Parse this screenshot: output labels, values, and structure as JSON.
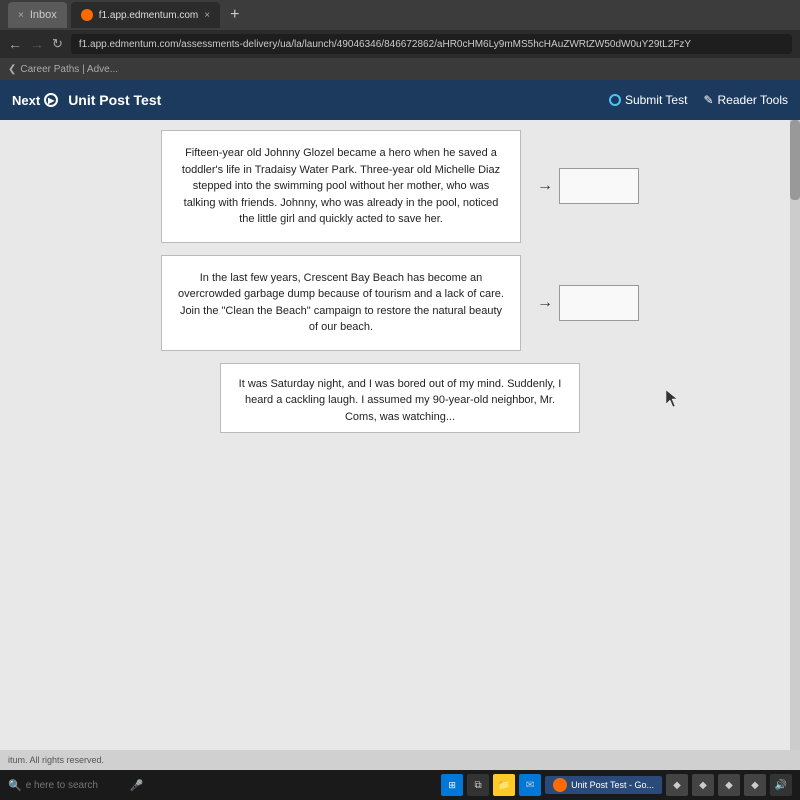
{
  "browser": {
    "tabs": [
      {
        "label": "×",
        "title": "Inbox",
        "active": false
      },
      {
        "label": "×",
        "title": "f1.app.edmentum.com/assessments-delivery/ua/la/launch/49046346/846672862/aHR0cHM6Ly9mMS5hcHAuZWRtZW50dW0uY29tL2FzY...",
        "active": true
      }
    ],
    "new_tab": "+",
    "address": "f1.app.edmentum.com/assessments-delivery/ua/la/launch/49046346/846672862/aHR0cHM6Ly9mMS5hcHAuZWRtZW50dW0uY29tL2FzY",
    "breadcrumb": "Career Paths | Adve..."
  },
  "header": {
    "next_label": "Next",
    "title": "Unit Post Test",
    "submit_label": "Submit Test",
    "reader_tools_label": "Reader Tools"
  },
  "passages": [
    {
      "text": "Fifteen-year old Johnny Glozel became a hero when he saved a toddler's life in Tradaisy Water Park. Three-year old Michelle Diaz stepped into the swimming pool without her mother, who was talking with friends. Johnny, who was already in the pool, noticed the little girl and quickly acted to save her."
    },
    {
      "text": "In the last few years, Crescent Bay Beach has become an overcrowded garbage dump because of tourism and a lack of care. Join the \"Clean the Beach\" campaign to restore the natural beauty of our beach."
    },
    {
      "text": "It was Saturday night, and I was bored out of my mind. Suddenly, I heard a cackling laugh. I assumed my 90-year-old neighbor, Mr. Coms, was watching..."
    }
  ],
  "footer": {
    "copyright": "itum. All rights reserved."
  },
  "taskbar": {
    "search_placeholder": "e here to search",
    "app_label": "Unit Post Test - Go..."
  }
}
